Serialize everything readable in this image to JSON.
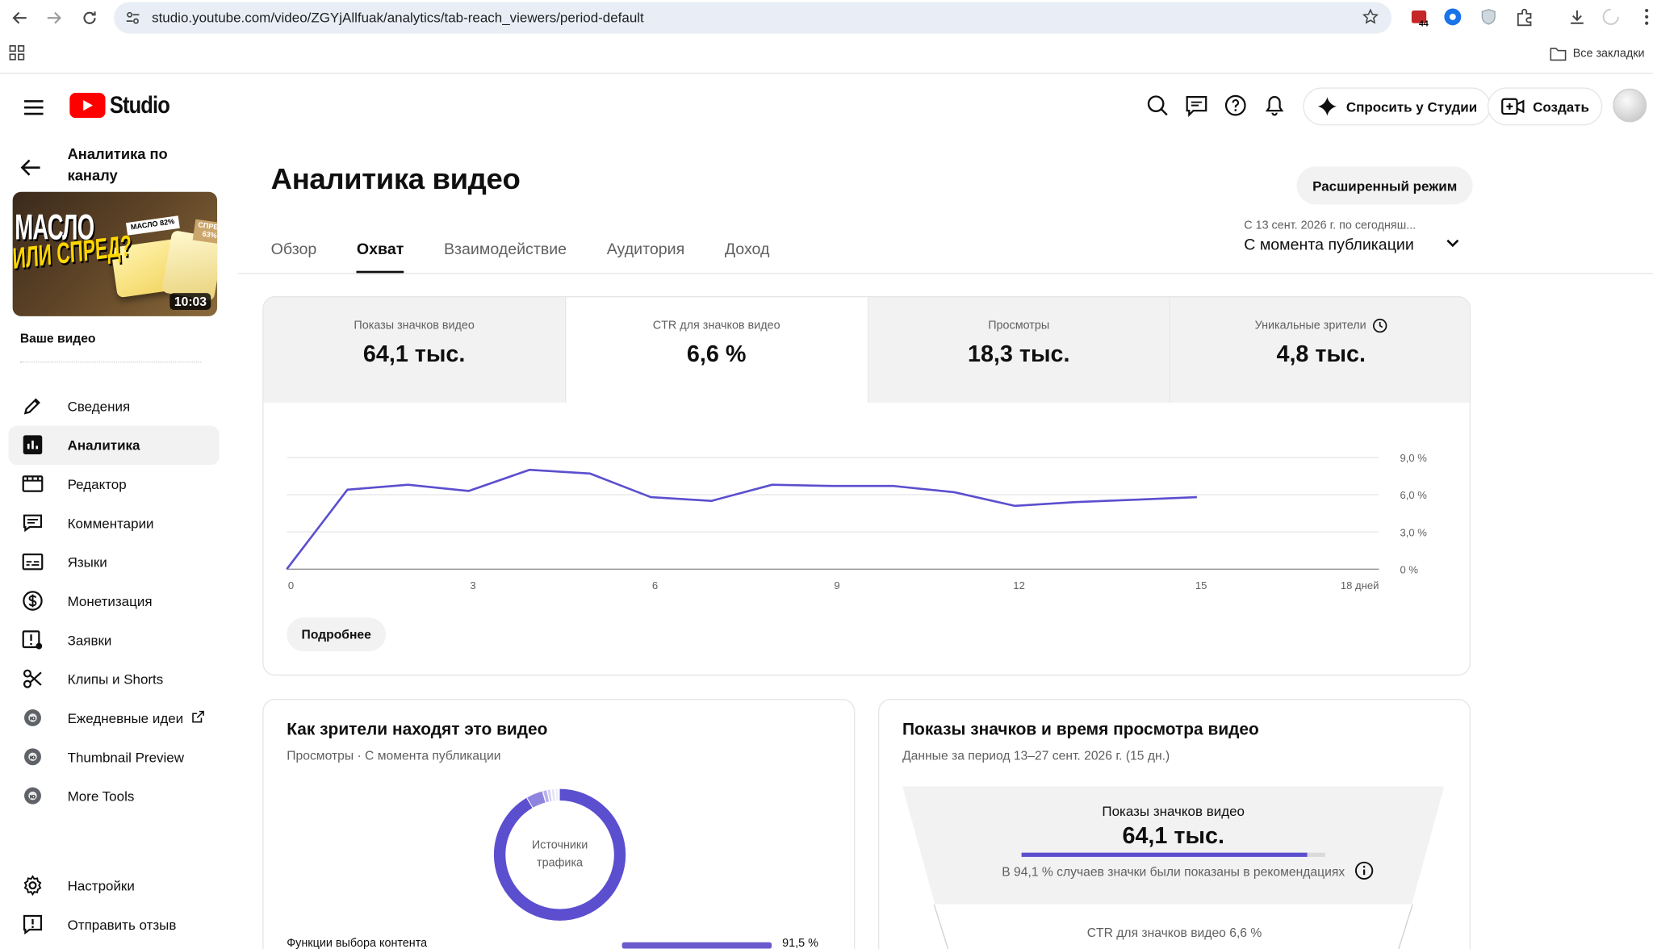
{
  "browser": {
    "url": "studio.youtube.com/video/ZGYjAllfuak/analytics/tab-reach_viewers/period-default",
    "ext_badge": "44",
    "all_bookmarks": "Все закладки"
  },
  "header": {
    "brand": "Studio",
    "ask_studio_label": "Спросить у Студии",
    "create_label": "Создать"
  },
  "sidebar": {
    "back_title": "Аналитика по каналу",
    "thumbnail": {
      "line1": "МАСЛО",
      "line2": "ИЛИ СПРЕД?",
      "tag1": "МАСЛО 82%",
      "tag2": "СПРЕД 63%",
      "duration": "10:03"
    },
    "your_video": "Ваше видео",
    "items": [
      {
        "label": "Сведения",
        "icon": "pencil-icon"
      },
      {
        "label": "Аналитика",
        "icon": "analytics-icon",
        "active": true
      },
      {
        "label": "Редактор",
        "icon": "editor-icon"
      },
      {
        "label": "Комментарии",
        "icon": "comments-icon"
      },
      {
        "label": "Языки",
        "icon": "subtitles-icon"
      },
      {
        "label": "Монетизация",
        "icon": "dollar-icon"
      },
      {
        "label": "Заявки",
        "icon": "claims-icon"
      },
      {
        "label": "Клипы и Shorts",
        "icon": "scissors-icon"
      },
      {
        "label": "Ежедневные идеи",
        "icon": "extension-icon"
      },
      {
        "label": "Thumbnail Preview",
        "icon": "extension-icon"
      },
      {
        "label": "More Tools",
        "icon": "extension-icon"
      }
    ],
    "bottom_items": [
      {
        "label": "Настройки",
        "icon": "gear-icon"
      },
      {
        "label": "Отправить отзыв",
        "icon": "feedback-icon"
      }
    ]
  },
  "main": {
    "title": "Аналитика видео",
    "advanced_mode": "Расширенный режим",
    "tabs": [
      "Обзор",
      "Охват",
      "Взаимодействие",
      "Аудитория",
      "Доход"
    ],
    "active_tab": "Охват",
    "period": {
      "range": "С 13 сент. 2026 г. по сегодняш...",
      "label": "С момента публикации"
    },
    "metrics": [
      {
        "label": "Показы значков видео",
        "value": "64,1 тыс."
      },
      {
        "label": "CTR для значков видео",
        "value": "6,6 %",
        "active": true
      },
      {
        "label": "Просмотры",
        "value": "18,3 тыс."
      },
      {
        "label": "Уникальные зрители",
        "value": "4,8 тыс."
      }
    ],
    "more_button": "Подробнее"
  },
  "chart_data": {
    "type": "line",
    "x": [
      0,
      1,
      2,
      3,
      4,
      5,
      6,
      7,
      8,
      9,
      10,
      11,
      12,
      13,
      14,
      15
    ],
    "values": [
      0,
      6.4,
      6.8,
      6.3,
      8.0,
      7.7,
      5.8,
      5.5,
      6.8,
      6.7,
      6.7,
      6.2,
      5.1,
      5.4,
      5.6,
      5.8
    ],
    "xticks": [
      "0",
      "3",
      "6",
      "9",
      "12",
      "15",
      "18 дней"
    ],
    "yticks": [
      "9,0 %",
      "6,0 %",
      "3,0 %",
      "0 %"
    ],
    "ylim": [
      0,
      9
    ],
    "xlim": [
      0,
      18
    ],
    "color": "#5b4fcf"
  },
  "traffic": {
    "title": "Как зрители находят это видео",
    "subtitle": "Просмотры · С момента публикации",
    "donut_label": "Источники трафика",
    "row_label": "Функции выбора контента",
    "row_pct": "91,5 %"
  },
  "funnel": {
    "title": "Показы значков и время просмотра видео",
    "subtitle": "Данные за период 13–27 сент. 2026 г. (15 дн.)",
    "impressions_label": "Показы значков видео",
    "impressions_value": "64,1 тыс.",
    "recommend_note": "В 94,1 % случаев значки были показаны в рекомендациях",
    "recommend_share": 0.941,
    "ctr_note": "CTR для значков видео 6,6 %"
  }
}
